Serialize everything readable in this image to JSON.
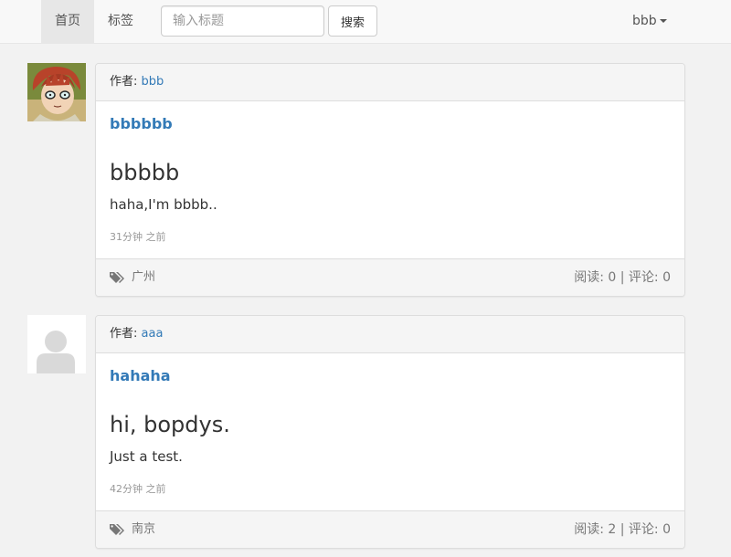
{
  "navbar": {
    "tabs": [
      {
        "label": "首页",
        "active": true
      },
      {
        "label": "标签",
        "active": false
      }
    ],
    "search": {
      "placeholder": "输入标题",
      "button_label": "搜索"
    },
    "user": {
      "name": "bbb"
    }
  },
  "posts": [
    {
      "author_prefix": "作者:",
      "author": "bbb",
      "title": "bbbbbb",
      "heading": "bbbbb",
      "text": "haha,I'm bbbb..",
      "time": "31分钟 之前",
      "tag": "广州",
      "stats": "阅读: 0 | 评论: 0",
      "avatar": "anime-character-avatar"
    },
    {
      "author_prefix": "作者:",
      "author": "aaa",
      "title": "hahaha",
      "heading": "hi, bopdys.",
      "text": "Just a test.",
      "time": "42分钟 之前",
      "tag": "南京",
      "stats": "阅读: 2 | 评论: 0",
      "avatar": "default-user-avatar"
    }
  ],
  "colors": {
    "link": "#337ab7",
    "muted": "#999999",
    "panel_bg": "#f5f5f5",
    "nav_active_bg": "#e7e7e7"
  }
}
